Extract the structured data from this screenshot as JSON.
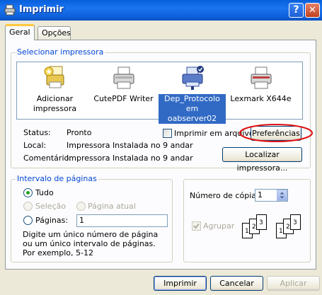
{
  "window": {
    "title": "Imprimir",
    "help_label": "?",
    "close_label": "✕"
  },
  "tabs": [
    {
      "label": "Geral",
      "active": true
    },
    {
      "label": "Opções",
      "active": false
    }
  ],
  "printer_group": {
    "title": "Selecionar impressora",
    "printers": [
      {
        "line1": "Adicionar",
        "line2": "impressora",
        "icon": "add-printer-icon"
      },
      {
        "line1": "CutePDF Writer",
        "line2": "",
        "icon": "printer-icon"
      },
      {
        "line1": "Dep_Protocolo em",
        "line2": "oabserver02",
        "icon": "network-printer-icon",
        "selected": true
      },
      {
        "line1": "Lexmark X644e",
        "line2": "",
        "icon": "printer-icon"
      }
    ],
    "status_label": "Status:",
    "status_value": "Pronto",
    "local_label": "Local:",
    "local_value": "Impressora Instalada no 9 andar",
    "comment_label": "Comentário:",
    "comment_value": "Impressora Instalada no 9 andar",
    "print_to_file_label": "Imprimir em arquivo",
    "preferences_button": "Preferências",
    "find_printer_button": "Localizar impressora..."
  },
  "page_range": {
    "title": "Intervalo de páginas",
    "all_label": "Tudo",
    "selection_label": "Seleção",
    "current_page_label": "Página atual",
    "pages_label": "Páginas:",
    "pages_value": "1",
    "help_text": "Digite um único número de página ou um único intervalo de páginas. Por exemplo, 5-12"
  },
  "copies": {
    "label": "Número de cópias:",
    "value": "1",
    "collate_label": "Agrupar",
    "collate_pages_1": [
      "1",
      "2",
      "3"
    ],
    "collate_pages_2": [
      "1",
      "2",
      "3"
    ]
  },
  "buttons": {
    "print": "Imprimir",
    "cancel": "Cancelar",
    "apply": "Aplicar"
  },
  "colors": {
    "accent": "#0046d5",
    "selection": "#316ac5",
    "highlight_circle": "#e01010"
  }
}
